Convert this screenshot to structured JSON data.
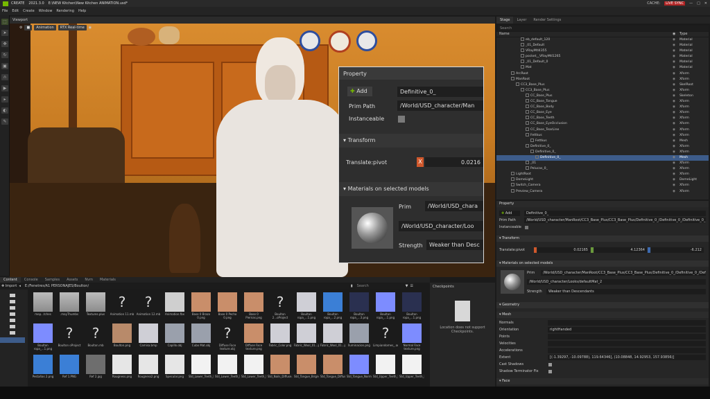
{
  "titlebar": {
    "app": "CREATE",
    "version": "2021.3.0",
    "file": "E:\\NEW Kitchen\\New Kitchen ANIMATION.usd*",
    "cache": "CACHE:",
    "live": "LIVE SYNC"
  },
  "menu": [
    "File",
    "Edit",
    "Create",
    "Window",
    "Rendering",
    "Help"
  ],
  "viewport": {
    "tab": "Viewport",
    "chips": [
      "Animation",
      "RTX Real-time"
    ]
  },
  "overlay": {
    "header": "Property",
    "add_label": "Add",
    "name_value": "Definitive_0_",
    "prim_path_label": "Prim Path",
    "prim_path_value": "/World/USD_character/Man",
    "instanceable_label": "Instanceable",
    "transform_label": "Transform",
    "translate_label": "Translate:pivot",
    "axis_x": "X",
    "translate_x": "0.0216",
    "materials_label": "Materials on selected models",
    "prim_label": "Prim",
    "prim_value": "/World/USD_chara",
    "material_value": "/World/USD_character/Loo",
    "strength_label": "Strength",
    "strength_value": "Weaker than Desc"
  },
  "stage": {
    "tabs": [
      "Stage",
      "Layer",
      "Render Settings"
    ],
    "search": "Search",
    "col_name": "Name",
    "col_type": "Type",
    "rows": [
      {
        "name": "eb_default_120",
        "type": "Material",
        "indent": 5
      },
      {
        "name": "_01_Default",
        "type": "Material",
        "indent": 5
      },
      {
        "name": "VRayMtl4355",
        "type": "Material",
        "indent": 5
      },
      {
        "name": "pocket__VRayMtl1265",
        "type": "Material",
        "indent": 5
      },
      {
        "name": "_01_Default_0",
        "type": "Material",
        "indent": 5
      },
      {
        "name": "Mat",
        "type": "Material",
        "indent": 5
      },
      {
        "name": "ArcRoot",
        "type": "Xform",
        "indent": 3
      },
      {
        "name": "ManRoot",
        "type": "Xform",
        "indent": 3
      },
      {
        "name": "CC3_Base_Plus",
        "type": "SkelRoot",
        "indent": 4
      },
      {
        "name": "CC3_Base_Plus",
        "type": "Xform",
        "indent": 5
      },
      {
        "name": "CC_Base_Plus",
        "type": "Skeleton",
        "indent": 6
      },
      {
        "name": "CC_Base_Tongue",
        "type": "Xform",
        "indent": 6
      },
      {
        "name": "CC_Base_Body",
        "type": "Xform",
        "indent": 6
      },
      {
        "name": "CC_Base_Eye",
        "type": "Xform",
        "indent": 6
      },
      {
        "name": "CC_Base_Teeth",
        "type": "Xform",
        "indent": 6
      },
      {
        "name": "CC_Base_EyeOcclusion",
        "type": "Xform",
        "indent": 6
      },
      {
        "name": "CC_Base_TearLine",
        "type": "Xform",
        "indent": 6
      },
      {
        "name": "Fettkus",
        "type": "Xform",
        "indent": 6
      },
      {
        "name": "Fettkus",
        "type": "Mesh",
        "indent": 7
      },
      {
        "name": "Definitive_0_",
        "type": "Xform",
        "indent": 6
      },
      {
        "name": "Definitive_0_",
        "type": "Xform",
        "indent": 7
      },
      {
        "name": "Definitive_0_",
        "type": "Mesh",
        "indent": 8,
        "selected": true
      },
      {
        "name": "_01",
        "type": "Xform",
        "indent": 6
      },
      {
        "name": "Pelucas_0_",
        "type": "Xform",
        "indent": 6
      },
      {
        "name": "LightRoot",
        "type": "Xform",
        "indent": 3
      },
      {
        "name": "DomeLight",
        "type": "DomeLight",
        "indent": 3
      },
      {
        "name": "Switch_Camera",
        "type": "Xform",
        "indent": 3
      },
      {
        "name": "Preview_Camera",
        "type": "Xform",
        "indent": 3
      }
    ]
  },
  "rprop": {
    "tab": "Property",
    "add": "Add",
    "name_value": "Definitive_0_",
    "prim_path_label": "Prim Path",
    "prim_path_value": "/World/USD_character/ManRoot/CC3_Base_Plus/CC3_Base_Plus/Definitive_0_/Definitive_0_/Definitive_0_",
    "instanceable_label": "Instanceable",
    "transform_label": "Transform",
    "translate_label": "Translate:pivot",
    "tx": "0.02165",
    "ty": "4.12364",
    "tz": "-6.212",
    "materials_label": "Materials on selected models",
    "prim_label": "Prim",
    "prim_value": "/World/USD_character/ManRoot/CC3_Base_Plus/CC3_Base_Plus/Definitive_0_/Definitive_0_/Definitive_0_",
    "mat_value": "/World/USD_character/Looks/defaultMat_2",
    "strength_label": "Strength",
    "strength_value": "Weaker than Descendants",
    "geometry_label": "Geometry",
    "mesh_label": "Mesh",
    "normals": "Normals",
    "orientation": "Orientation",
    "orientation_value": "rightHanded",
    "points": "Points",
    "velocities": "Velocities",
    "accelerations": "Accelerations",
    "extent": "Extent",
    "extent_value": "[(-1.39297, -10.09788), 119.64346], (10.08848, 14.92953, 157.93856)]",
    "cast_shadows": "Cast Shadows",
    "shadow_term": "Shadow Terminator Fix",
    "face_label": "Face"
  },
  "content": {
    "tabs": [
      "Content",
      "Console",
      "Samples",
      "Assets",
      "Nvm",
      "Materials"
    ],
    "import": "Import",
    "path": "E:/Fenetres/A1 PERSONAJES/Boulton/",
    "search": "Search",
    "checkpoints_title": "Checkpoints",
    "checkpoints_msg": "Location does not support Checkpoints.",
    "files": [
      {
        "label": "mep...tches",
        "kind": "folder"
      },
      {
        "label": ".mayThumbs",
        "kind": "folder"
      },
      {
        "label": "Textures.plus",
        "kind": "folder"
      },
      {
        "label": "Animation 11.mb",
        "kind": "unknown"
      },
      {
        "label": "Animation 12.mb",
        "kind": "unknown"
      },
      {
        "label": "Animation.fbx",
        "kind": "fbx"
      },
      {
        "label": "Base 0 Brazo 0.png",
        "kind": "skin"
      },
      {
        "label": "Base 0 Pecho 0.png",
        "kind": "skin"
      },
      {
        "label": "Base 0 Piernas.png",
        "kind": "skin"
      },
      {
        "label": "Boulton 2...oProject",
        "kind": "unknown"
      },
      {
        "label": "Boulton ropa_...1.png",
        "kind": "cloth"
      },
      {
        "label": "Boulton ropa_...2.png",
        "kind": "blue"
      },
      {
        "label": "Boulton ropa_...3.png",
        "kind": "dark"
      },
      {
        "label": "Boulton ropa_...1.png",
        "kind": "normal"
      },
      {
        "label": "Boulton ropa_...1.png",
        "kind": "dark"
      },
      {
        "label": "Boulton ropa_...1.png",
        "kind": "normal"
      },
      {
        "label": "Boulton oProject",
        "kind": "unknown"
      },
      {
        "label": "Boulton.mb",
        "kind": "unknown"
      },
      {
        "label": "Boulton.png",
        "kind": "char"
      },
      {
        "label": "Camisa.bmp",
        "kind": "cloth"
      },
      {
        "label": "Capillo.obj",
        "kind": "obj"
      },
      {
        "label": "Cubo Mat.obj",
        "kind": "obj"
      },
      {
        "label": "Diffuse Face texture.obj",
        "kind": "unknown"
      },
      {
        "label": "Diffuse Face texture.png",
        "kind": "skin"
      },
      {
        "label": "Fabric_Color.png",
        "kind": "cloth"
      },
      {
        "label": "Fabric_Wool_01...png",
        "kind": "cloth"
      },
      {
        "label": "Fabric_Wool_01...png",
        "kind": "cloth"
      },
      {
        "label": "lluminacion.png",
        "kind": "obj"
      },
      {
        "label": "Limpiandomes_.ani",
        "kind": "unknown"
      },
      {
        "label": "Normal Face texture.png",
        "kind": "normal"
      },
      {
        "label": "Pestañas 2.png",
        "kind": "blue"
      },
      {
        "label": "Ref 1.PNG",
        "kind": "blue"
      },
      {
        "label": "Ref 2.jpg",
        "kind": "photo"
      },
      {
        "label": "Rougness.png",
        "kind": "white"
      },
      {
        "label": "Rougness2.png",
        "kind": "white"
      },
      {
        "label": "Specular.png",
        "kind": "white"
      },
      {
        "label": "Std_Lower_Teeth_B...png",
        "kind": "teeth"
      },
      {
        "label": "Std_Lower_Teeth_N...png",
        "kind": "teeth"
      },
      {
        "label": "Std_Lower_Teeth_N...png",
        "kind": "teeth"
      },
      {
        "label": "Std_Nails_Diffuse.png",
        "kind": "skin"
      },
      {
        "label": "Std_Tongue_Brigness.png",
        "kind": "skin"
      },
      {
        "label": "Std_Tongue_Diffuse.png",
        "kind": "skin"
      },
      {
        "label": "Std_Tongue_Normal.png",
        "kind": "normal"
      },
      {
        "label": "Std_Upper_Teeth_B...png",
        "kind": "teeth"
      },
      {
        "label": "Std_Upper_Teeth_N...png",
        "kind": "teeth"
      }
    ]
  },
  "colors": {
    "accent": "#76b900",
    "select": "#3d5c8a",
    "axis_x": "#d0582c",
    "axis_y": "#6a9a3c",
    "axis_z": "#3c6ab0"
  }
}
